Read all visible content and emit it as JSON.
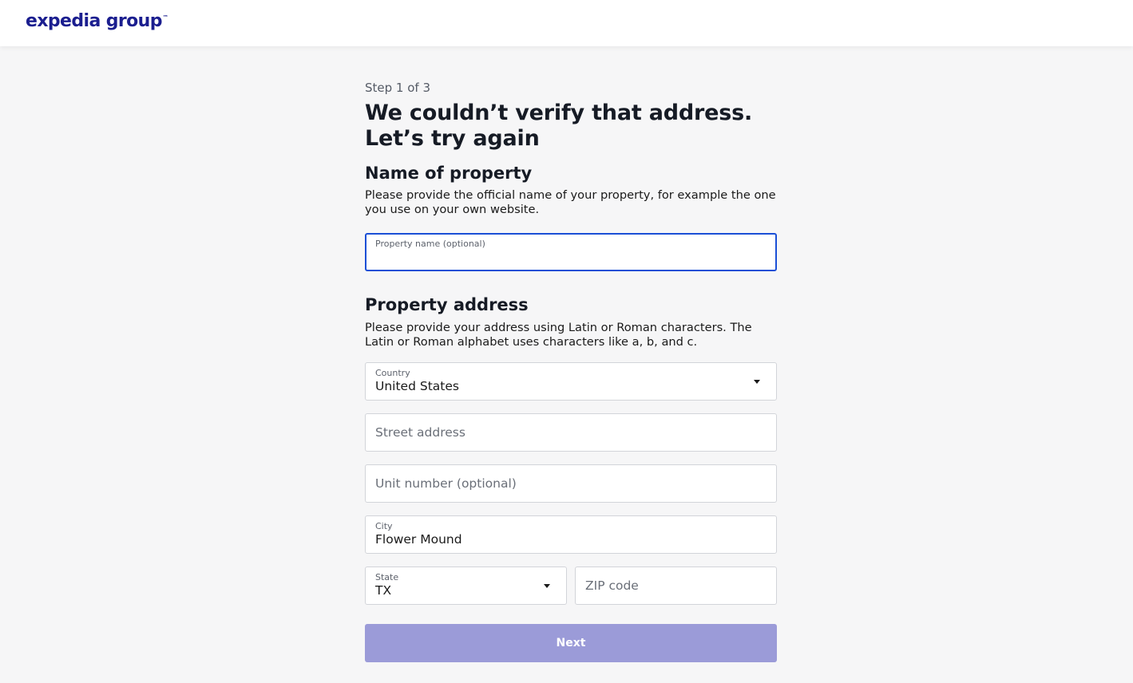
{
  "brand": {
    "logo_text": "expedia group",
    "logo_mark": "™",
    "color": "#1b1e8f"
  },
  "form": {
    "step": "Step 1 of 3",
    "title": "We couldn’t verify that address. Let’s try again",
    "name_section": {
      "title": "Name of property",
      "description": "Please provide the official name of your property, for example the one you use on your own website.",
      "property_name": {
        "label": "Property name (optional)",
        "value": ""
      }
    },
    "address_section": {
      "title": "Property address",
      "description": "Please provide your address using Latin or Roman characters. The Latin or Roman alphabet uses characters like a, b, and c.",
      "country": {
        "label": "Country",
        "value": "United States"
      },
      "street": {
        "placeholder": "Street address"
      },
      "unit": {
        "placeholder": "Unit number (optional)"
      },
      "city": {
        "label": "City",
        "value": "Flower Mound"
      },
      "state": {
        "label": "State",
        "value": "TX"
      },
      "zip": {
        "placeholder": "ZIP code"
      }
    },
    "next_label": "Next"
  },
  "colors": {
    "focus_border": "#1a4fd6",
    "button_disabled": "#9b9bd8",
    "page_background": "#f6f6f7"
  }
}
